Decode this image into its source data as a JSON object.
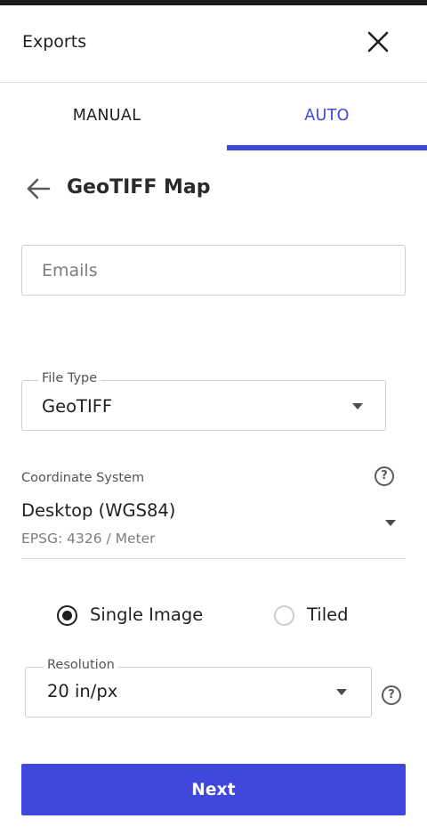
{
  "header": {
    "title": "Exports"
  },
  "tabs": [
    {
      "label": "MANUAL",
      "active": false
    },
    {
      "label": "AUTO",
      "active": true
    }
  ],
  "form": {
    "title": "GeoTIFF Map",
    "emails": {
      "placeholder": "Emails",
      "value": ""
    },
    "file_type": {
      "label": "File Type",
      "value": "GeoTIFF"
    },
    "coordinate_system": {
      "label": "Coordinate System",
      "value": "Desktop (WGS84)",
      "sub": "EPSG: 4326 / Meter"
    },
    "image_mode": {
      "options": [
        {
          "label": "Single Image",
          "selected": true
        },
        {
          "label": "Tiled",
          "selected": false
        }
      ]
    },
    "resolution": {
      "label": "Resolution",
      "value": "20 in/px"
    },
    "help_glyph": "?",
    "submit_label": "Next"
  },
  "colors": {
    "accent": "#3f48db",
    "text": "#1f1f1f",
    "muted": "#7d7d7d",
    "border": "#cfcfcf"
  },
  "icons": {
    "close": "close-icon",
    "back": "arrow-left-icon",
    "help": "help-circle-icon",
    "caret": "caret-down-icon"
  }
}
